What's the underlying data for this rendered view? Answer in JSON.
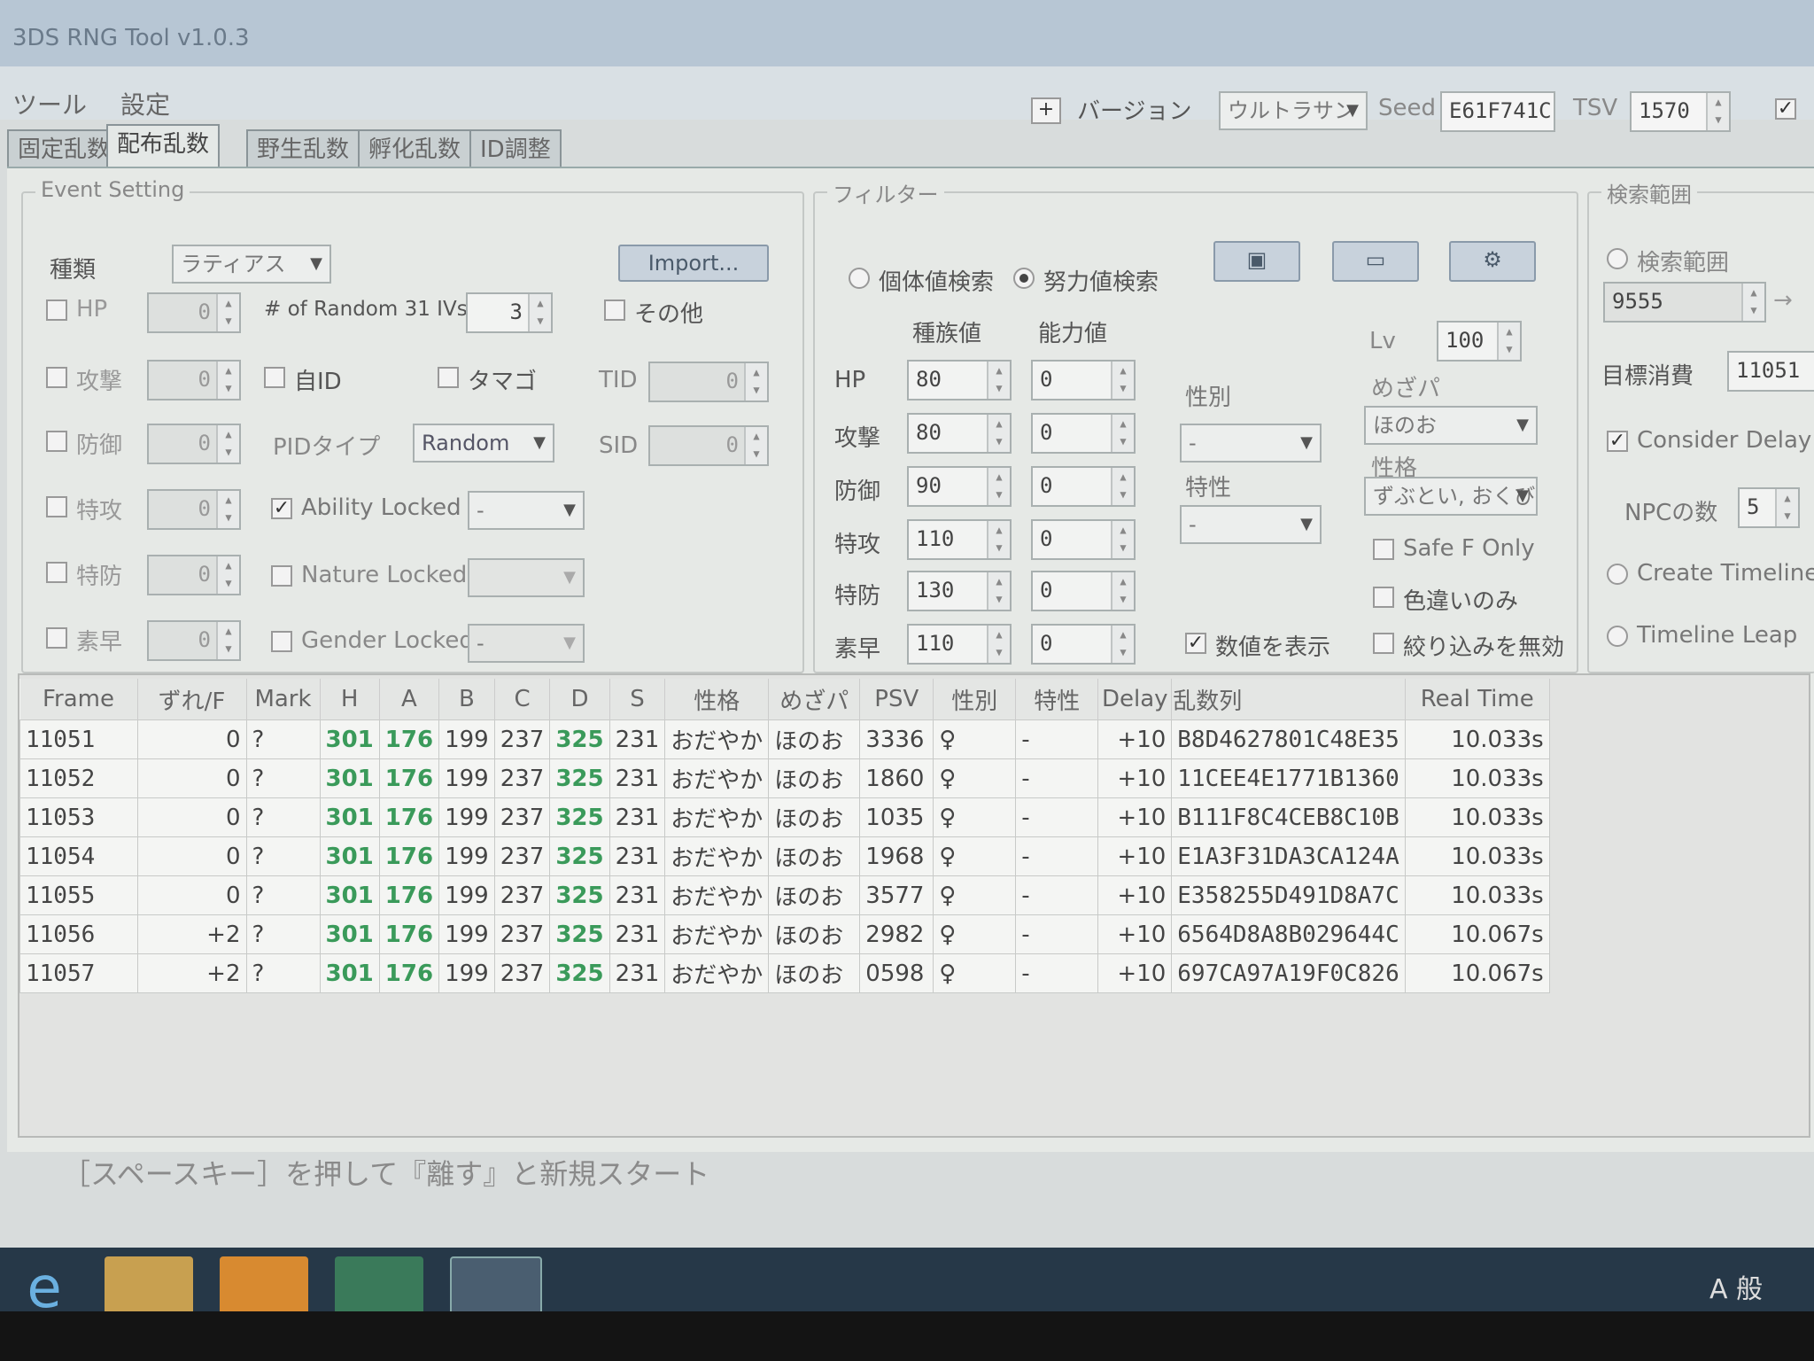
{
  "window": {
    "title": "3DS RNG Tool v1.0.3"
  },
  "menu": [
    "ツール",
    "設定"
  ],
  "toolbar": {
    "version_label": "バージョン",
    "version_value": "ウルトラサン",
    "seed_label": "Seed",
    "seed_value": "E61F741C",
    "tsv_label": "TSV",
    "tsv_value": "1570"
  },
  "tabs": [
    "固定乱数",
    "配布乱数",
    "野生乱数",
    "孵化乱数",
    "ID調整"
  ],
  "event_setting": {
    "legend": "Event Setting",
    "kind_label": "種類",
    "kind_value": "ラティアス",
    "import_label": "Import...",
    "stats": [
      {
        "label": "HP",
        "value": "0"
      },
      {
        "label": "攻撃",
        "value": "0"
      },
      {
        "label": "防御",
        "value": "0"
      },
      {
        "label": "特攻",
        "value": "0"
      },
      {
        "label": "特防",
        "value": "0"
      },
      {
        "label": "素早",
        "value": "0"
      }
    ],
    "random31_label": "# of Random 31 IVs",
    "random31_value": "3",
    "other_label": "その他",
    "own_id_label": "自ID",
    "egg_label": "タマゴ",
    "tid_label": "TID",
    "tid_value": "0",
    "sid_label": "SID",
    "sid_value": "0",
    "pid_type_label": "PIDタイプ",
    "pid_type_value": "Random",
    "ability_locked_label": "Ability Locked",
    "ability_locked_value": "-",
    "nature_locked_label": "Nature Locked",
    "nature_locked_value": "",
    "gender_locked_label": "Gender Locked",
    "gender_locked_value": "-"
  },
  "filter": {
    "legend": "フィルター",
    "iv_search_label": "個体値検索",
    "ev_search_label": "努力値検索",
    "col_base": "種族値",
    "col_stat": "能力値",
    "rows": [
      {
        "label": "HP",
        "base": "80",
        "stat": "0"
      },
      {
        "label": "攻撃",
        "base": "80",
        "stat": "0"
      },
      {
        "label": "防御",
        "base": "90",
        "stat": "0"
      },
      {
        "label": "特攻",
        "base": "110",
        "stat": "0"
      },
      {
        "label": "特防",
        "base": "130",
        "stat": "0"
      },
      {
        "label": "素早",
        "base": "110",
        "stat": "0"
      }
    ],
    "gender_label": "性別",
    "gender_value": "-",
    "ability_label": "特性",
    "ability_value": "-",
    "lv_label": "Lv",
    "lv_value": "100",
    "hp_type_label": "めざパ",
    "hp_type_value": "ほのお",
    "nature_label": "性格",
    "nature_value": "ずぶとい, おくび",
    "safe_f_label": "Safe F Only",
    "shiny_label": "色違いのみ",
    "show_stats_label": "数値を表示",
    "disable_filter_label": "絞り込みを無効"
  },
  "search_range": {
    "legend": "検索範囲",
    "radio_label": "検索範囲",
    "start_value": "9555",
    "target_label": "目標消費",
    "target_value": "11051",
    "consider_delay_label": "Consider Delay",
    "npc_label": "NPCの数",
    "npc_value": "5",
    "create_timeline_label": "Create Timeline/s",
    "timeline_leap_label": "Timeline Leap"
  },
  "table": {
    "columns": [
      "Frame",
      "ずれ/F",
      "Mark",
      "H",
      "A",
      "B",
      "C",
      "D",
      "S",
      "性格",
      "めざパ",
      "PSV",
      "性別",
      "特性",
      "Delay",
      "乱数列",
      "Real Time"
    ],
    "rows": [
      [
        "11051",
        "0",
        "?",
        "301",
        "176",
        "199",
        "237",
        "325",
        "231",
        "おだやか",
        "ほのお",
        "3336",
        "♀",
        "-",
        "+10",
        "B8D4627801C48E35",
        "10.033s"
      ],
      [
        "11052",
        "0",
        "?",
        "301",
        "176",
        "199",
        "237",
        "325",
        "231",
        "おだやか",
        "ほのお",
        "1860",
        "♀",
        "-",
        "+10",
        "11CEE4E1771B1360",
        "10.033s"
      ],
      [
        "11053",
        "0",
        "?",
        "301",
        "176",
        "199",
        "237",
        "325",
        "231",
        "おだやか",
        "ほのお",
        "1035",
        "♀",
        "-",
        "+10",
        "B111F8C4CEB8C10B",
        "10.033s"
      ],
      [
        "11054",
        "0",
        "?",
        "301",
        "176",
        "199",
        "237",
        "325",
        "231",
        "おだやか",
        "ほのお",
        "1968",
        "♀",
        "-",
        "+10",
        "E1A3F31DA3CA124A",
        "10.033s"
      ],
      [
        "11055",
        "0",
        "?",
        "301",
        "176",
        "199",
        "237",
        "325",
        "231",
        "おだやか",
        "ほのお",
        "3577",
        "♀",
        "-",
        "+10",
        "E358255D491D8A7C",
        "10.033s"
      ],
      [
        "11056",
        "+2",
        "?",
        "301",
        "176",
        "199",
        "237",
        "325",
        "231",
        "おだやか",
        "ほのお",
        "2982",
        "♀",
        "-",
        "+10",
        "6564D8A8B029644C",
        "10.067s"
      ],
      [
        "11057",
        "+2",
        "?",
        "301",
        "176",
        "199",
        "237",
        "325",
        "231",
        "おだやか",
        "ほのお",
        "0598",
        "♀",
        "-",
        "+10",
        "697CA97A19F0C826",
        "10.067s"
      ]
    ]
  },
  "hint_text": "［スペースキー］を押して『離す』と新規スタート",
  "taskbar": {
    "ime": "A 般"
  }
}
